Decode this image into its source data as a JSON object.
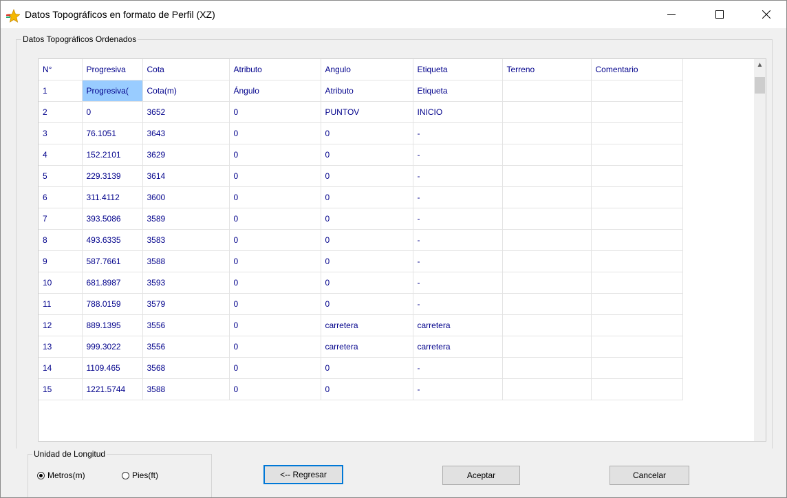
{
  "window": {
    "title": "Datos Topográficos en formato de Perfil (XZ)"
  },
  "group_data": {
    "label": "Datos Topográficos Ordenados"
  },
  "table": {
    "headers": [
      "N°",
      "Progresiva",
      "Cota",
      "Atributo",
      "Angulo",
      "Etiqueta",
      "Terreno",
      "Comentario"
    ],
    "rows": [
      [
        "1",
        "Progresiva(",
        "Cota(m)",
        "Ángulo",
        "Atributo",
        "Etiqueta",
        "",
        ""
      ],
      [
        "2",
        "0",
        "3652",
        "0",
        "PUNTOV",
        "INICIO",
        "",
        ""
      ],
      [
        "3",
        "76.1051",
        "3643",
        "0",
        "0",
        "-",
        "",
        ""
      ],
      [
        "4",
        "152.2101",
        "3629",
        "0",
        "0",
        "-",
        "",
        ""
      ],
      [
        "5",
        "229.3139",
        "3614",
        "0",
        "0",
        "-",
        "",
        ""
      ],
      [
        "6",
        "311.4112",
        "3600",
        "0",
        "0",
        "-",
        "",
        ""
      ],
      [
        "7",
        "393.5086",
        "3589",
        "0",
        "0",
        "-",
        "",
        ""
      ],
      [
        "8",
        "493.6335",
        "3583",
        "0",
        "0",
        "-",
        "",
        ""
      ],
      [
        "9",
        "587.7661",
        "3588",
        "0",
        "0",
        "-",
        "",
        ""
      ],
      [
        "10",
        "681.8987",
        "3593",
        "0",
        "0",
        "-",
        "",
        ""
      ],
      [
        "11",
        "788.0159",
        "3579",
        "0",
        "0",
        "-",
        "",
        ""
      ],
      [
        "12",
        "889.1395",
        "3556",
        "0",
        "carretera",
        "carretera",
        "",
        ""
      ],
      [
        "13",
        "999.3022",
        "3556",
        "0",
        "carretera",
        "carretera",
        "",
        ""
      ],
      [
        "14",
        "1109.465",
        "3568",
        "0",
        "0",
        "-",
        "",
        ""
      ],
      [
        "15",
        "1221.5744",
        "3588",
        "0",
        "0",
        "-",
        "",
        ""
      ]
    ],
    "highlighted_cell": {
      "row": 0,
      "col": 1,
      "color": "#99ccff"
    }
  },
  "units": {
    "label": "Unidad de Longitud",
    "options": [
      {
        "label": "Metros(m)",
        "selected": true
      },
      {
        "label": "Pies(ft)",
        "selected": false
      }
    ]
  },
  "buttons": {
    "back": "<-- Regresar",
    "accept": "Aceptar",
    "cancel": "Cancelar"
  },
  "colors": {
    "cell_text": "#00008b",
    "focus_border": "#0078d7"
  }
}
